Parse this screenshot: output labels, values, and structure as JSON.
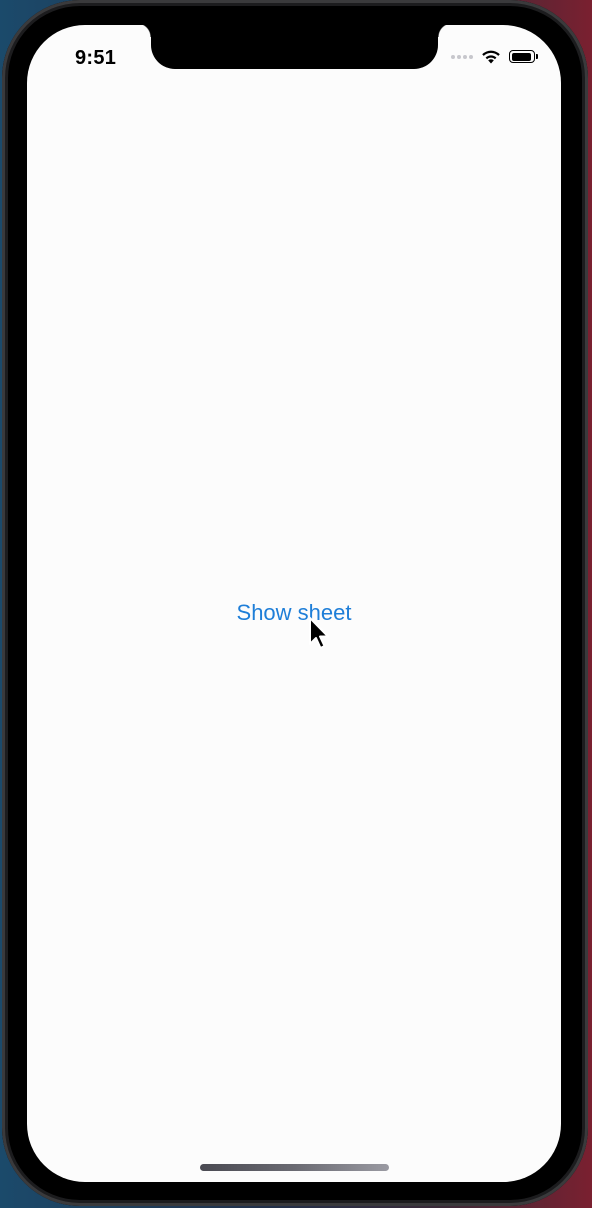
{
  "status_bar": {
    "time": "9:51",
    "battery_level": 0.95
  },
  "main": {
    "show_sheet_label": "Show sheet"
  },
  "colors": {
    "accent": "#1e7ed8",
    "background": "#fcfcfc"
  },
  "icons": [
    "cellular-signal-icon",
    "wifi-icon",
    "battery-icon",
    "mouse-pointer-icon"
  ]
}
